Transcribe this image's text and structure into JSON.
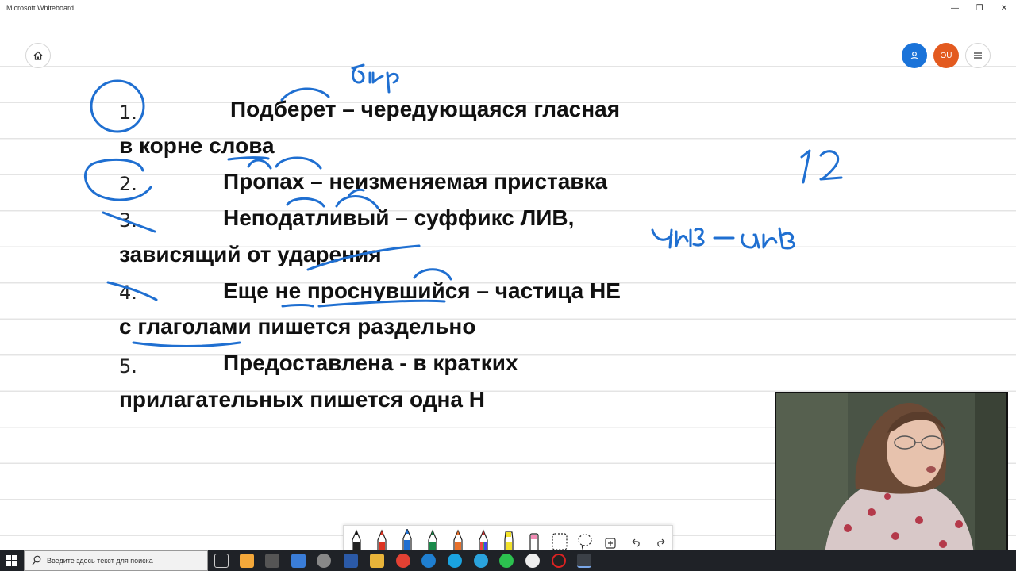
{
  "window": {
    "title": "Microsoft Whiteboard",
    "controls": {
      "minimize": "—",
      "restore": "❐",
      "close": "✕"
    }
  },
  "header": {
    "avatar_initials": "OU",
    "icons": [
      "home-icon",
      "invite-person-icon",
      "menu-icon"
    ]
  },
  "board": {
    "numbers": [
      "1.",
      "2.",
      "3.",
      "4.",
      "5."
    ],
    "lines": [
      "Подберет – чередующаяся гласная",
      "в корне слова",
      "Пропах – неизменяемая приставка",
      "Неподатливый – суффикс ЛИВ,",
      "зависящий от ударения",
      "Еще не проснувшийся – частица НЕ",
      "с глаголами пишется раздельно",
      "Предоставлена  - в кратких",
      "прилагательных пишется одна Н"
    ],
    "handwriting": {
      "top": "бир",
      "right_number": "12",
      "right_note": "чив-лив"
    },
    "ink_color": "#1f6fd1"
  },
  "toolbar": {
    "tools": [
      "black-pen",
      "red-pen",
      "blue-pen",
      "green-pen",
      "orange-pen",
      "rainbow-pen",
      "highlighter-yellow",
      "eraser-pink",
      "ruler",
      "lasso",
      "add",
      "undo",
      "redo"
    ]
  },
  "taskbar": {
    "search_placeholder": "Введите здесь текст для поиска",
    "apps": [
      "task-view",
      "store",
      "calculator",
      "remote",
      "misc",
      "word",
      "explorer",
      "chrome",
      "edge",
      "skype",
      "telegram",
      "whatsapp",
      "webcam-app",
      "record",
      "whiteboard"
    ]
  }
}
